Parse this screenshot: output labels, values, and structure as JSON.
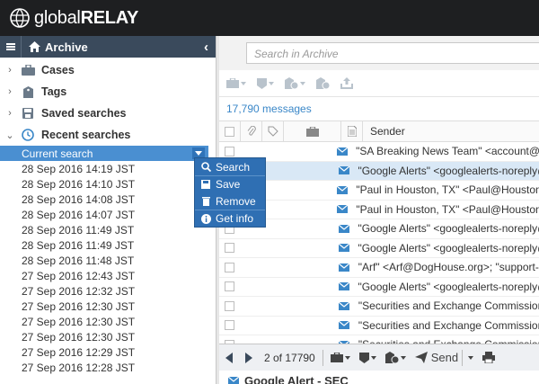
{
  "brand": {
    "name_part1": "global",
    "name_part2": "RELAY"
  },
  "sidebar": {
    "header_title": "Archive",
    "items": [
      {
        "label": "Cases",
        "icon": "briefcase-icon"
      },
      {
        "label": "Tags",
        "icon": "tag-icon"
      },
      {
        "label": "Saved searches",
        "icon": "save-icon"
      },
      {
        "label": "Recent searches",
        "icon": "clock-icon"
      }
    ],
    "current_search": "Current search",
    "recent": [
      "28 Sep 2016 14:19 JST",
      "28 Sep 2016 14:10 JST",
      "28 Sep 2016 14:08 JST",
      "28 Sep 2016 14:07 JST",
      "28 Sep 2016 11:49 JST",
      "28 Sep 2016 11:49 JST",
      "28 Sep 2016 11:48 JST",
      "27 Sep 2016 12:43 JST",
      "27 Sep 2016 12:32 JST",
      "27 Sep 2016 12:30 JST",
      "27 Sep 2016 12:30 JST",
      "27 Sep 2016 12:30 JST",
      "27 Sep 2016 12:29 JST",
      "27 Sep 2016 12:28 JST"
    ]
  },
  "context_menu": {
    "items": [
      {
        "label": "Search",
        "icon": "search-icon"
      },
      {
        "label": "Save",
        "icon": "floppy-icon"
      },
      {
        "label": "Remove",
        "icon": "trash-icon"
      },
      {
        "label": "Get info",
        "icon": "info-icon"
      }
    ]
  },
  "main": {
    "search_placeholder": "Search in Archive",
    "message_count": "17,790 messages",
    "column_sender": "Sender",
    "messages": [
      {
        "sender": "\"SA Breaking News Team\" <account@se",
        "selected": false
      },
      {
        "sender": "\"Google Alerts\" <googlealerts-noreply@",
        "selected": true
      },
      {
        "sender": "\"Paul in Houston, TX\" <Paul@Houston.T",
        "selected": false
      },
      {
        "sender": "\"Paul in Houston, TX\" <Paul@Houston.T",
        "selected": false
      },
      {
        "sender": "\"Google Alerts\" <googlealerts-noreply@",
        "selected": false
      },
      {
        "sender": "\"Google Alerts\" <googlealerts-noreply@",
        "selected": false
      },
      {
        "sender": "\"Arf\" <Arf@DogHouse.org>; \"support-fir",
        "selected": false
      },
      {
        "sender": "\"Google Alerts\" <googlealerts-noreply@",
        "selected": false
      },
      {
        "sender": "\"Securities and Exchange Commission\"",
        "selected": false
      },
      {
        "sender": "\"Securities and Exchange Commission\"",
        "selected": false
      },
      {
        "sender": "\"Securities and Exchange Commission\"",
        "selected": false
      }
    ],
    "pager": "2 of 17790",
    "send_label": "Send",
    "preview_subject": "Google Alert - SEC"
  },
  "colors": {
    "accent": "#4a8fd1",
    "topbar": "#1e1f21",
    "sidebar_header": "#3a4a5c",
    "menu": "#2f6fb3"
  }
}
